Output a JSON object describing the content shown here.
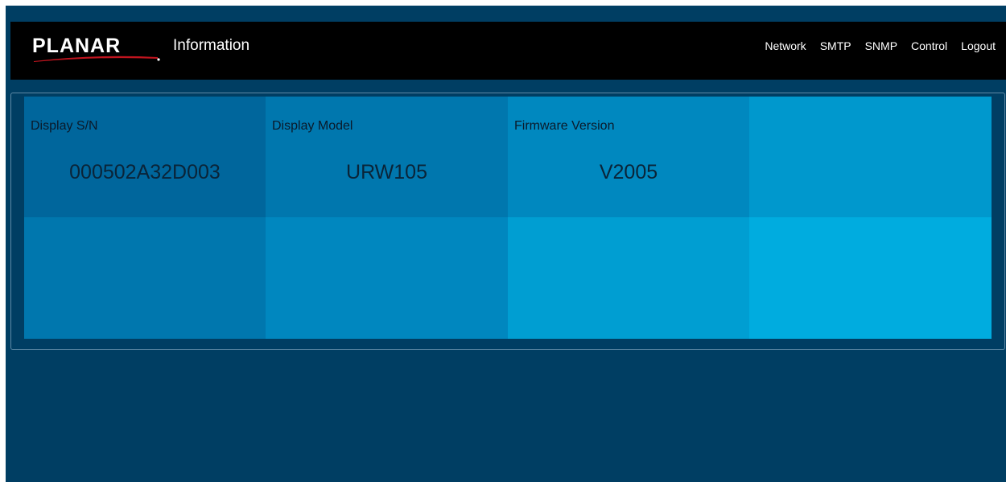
{
  "header": {
    "logo_text": "PLANAR",
    "title": "Information",
    "nav": [
      "Network",
      "SMTP",
      "SNMP",
      "Control",
      "Logout"
    ]
  },
  "tiles": [
    {
      "label": "Display S/N",
      "value": "000502A32D003",
      "color": "#00669c"
    },
    {
      "label": "Display Model",
      "value": "URW105",
      "color": "#0077ae"
    },
    {
      "label": "Firmware Version",
      "value": "V2005",
      "color": "#0088bf"
    },
    {
      "label": "",
      "value": "",
      "color": "#0098cd"
    },
    {
      "label": "",
      "value": "",
      "color": "#0077ae"
    },
    {
      "label": "",
      "value": "",
      "color": "#0087bf"
    },
    {
      "label": "",
      "value": "",
      "color": "#009ed2"
    },
    {
      "label": "",
      "value": "",
      "color": "#00acdf"
    }
  ],
  "colors": {
    "background": "#003e63",
    "header": "#000000",
    "logo_swoosh": "#c0141e"
  }
}
